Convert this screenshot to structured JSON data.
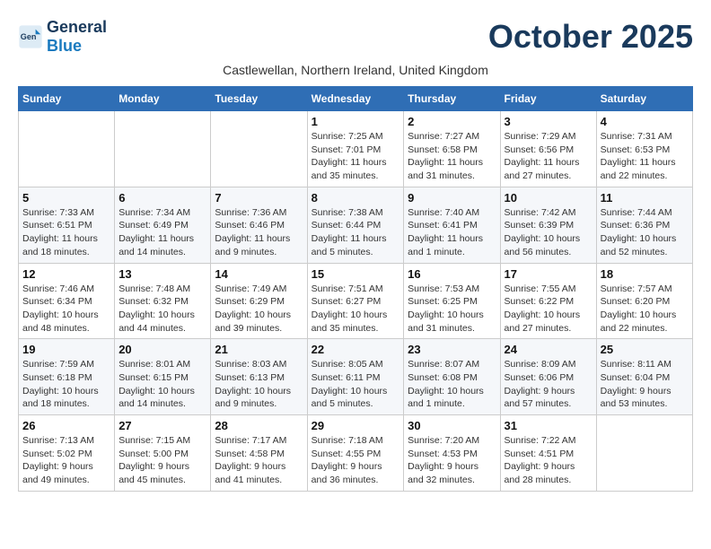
{
  "header": {
    "logo_general": "General",
    "logo_blue": "Blue",
    "month_title": "October 2025",
    "subtitle": "Castlewellan, Northern Ireland, United Kingdom"
  },
  "weekdays": [
    "Sunday",
    "Monday",
    "Tuesday",
    "Wednesday",
    "Thursday",
    "Friday",
    "Saturday"
  ],
  "weeks": [
    [
      {
        "day": "",
        "info": ""
      },
      {
        "day": "",
        "info": ""
      },
      {
        "day": "",
        "info": ""
      },
      {
        "day": "1",
        "info": "Sunrise: 7:25 AM\nSunset: 7:01 PM\nDaylight: 11 hours and 35 minutes."
      },
      {
        "day": "2",
        "info": "Sunrise: 7:27 AM\nSunset: 6:58 PM\nDaylight: 11 hours and 31 minutes."
      },
      {
        "day": "3",
        "info": "Sunrise: 7:29 AM\nSunset: 6:56 PM\nDaylight: 11 hours and 27 minutes."
      },
      {
        "day": "4",
        "info": "Sunrise: 7:31 AM\nSunset: 6:53 PM\nDaylight: 11 hours and 22 minutes."
      }
    ],
    [
      {
        "day": "5",
        "info": "Sunrise: 7:33 AM\nSunset: 6:51 PM\nDaylight: 11 hours and 18 minutes."
      },
      {
        "day": "6",
        "info": "Sunrise: 7:34 AM\nSunset: 6:49 PM\nDaylight: 11 hours and 14 minutes."
      },
      {
        "day": "7",
        "info": "Sunrise: 7:36 AM\nSunset: 6:46 PM\nDaylight: 11 hours and 9 minutes."
      },
      {
        "day": "8",
        "info": "Sunrise: 7:38 AM\nSunset: 6:44 PM\nDaylight: 11 hours and 5 minutes."
      },
      {
        "day": "9",
        "info": "Sunrise: 7:40 AM\nSunset: 6:41 PM\nDaylight: 11 hours and 1 minute."
      },
      {
        "day": "10",
        "info": "Sunrise: 7:42 AM\nSunset: 6:39 PM\nDaylight: 10 hours and 56 minutes."
      },
      {
        "day": "11",
        "info": "Sunrise: 7:44 AM\nSunset: 6:36 PM\nDaylight: 10 hours and 52 minutes."
      }
    ],
    [
      {
        "day": "12",
        "info": "Sunrise: 7:46 AM\nSunset: 6:34 PM\nDaylight: 10 hours and 48 minutes."
      },
      {
        "day": "13",
        "info": "Sunrise: 7:48 AM\nSunset: 6:32 PM\nDaylight: 10 hours and 44 minutes."
      },
      {
        "day": "14",
        "info": "Sunrise: 7:49 AM\nSunset: 6:29 PM\nDaylight: 10 hours and 39 minutes."
      },
      {
        "day": "15",
        "info": "Sunrise: 7:51 AM\nSunset: 6:27 PM\nDaylight: 10 hours and 35 minutes."
      },
      {
        "day": "16",
        "info": "Sunrise: 7:53 AM\nSunset: 6:25 PM\nDaylight: 10 hours and 31 minutes."
      },
      {
        "day": "17",
        "info": "Sunrise: 7:55 AM\nSunset: 6:22 PM\nDaylight: 10 hours and 27 minutes."
      },
      {
        "day": "18",
        "info": "Sunrise: 7:57 AM\nSunset: 6:20 PM\nDaylight: 10 hours and 22 minutes."
      }
    ],
    [
      {
        "day": "19",
        "info": "Sunrise: 7:59 AM\nSunset: 6:18 PM\nDaylight: 10 hours and 18 minutes."
      },
      {
        "day": "20",
        "info": "Sunrise: 8:01 AM\nSunset: 6:15 PM\nDaylight: 10 hours and 14 minutes."
      },
      {
        "day": "21",
        "info": "Sunrise: 8:03 AM\nSunset: 6:13 PM\nDaylight: 10 hours and 9 minutes."
      },
      {
        "day": "22",
        "info": "Sunrise: 8:05 AM\nSunset: 6:11 PM\nDaylight: 10 hours and 5 minutes."
      },
      {
        "day": "23",
        "info": "Sunrise: 8:07 AM\nSunset: 6:08 PM\nDaylight: 10 hours and 1 minute."
      },
      {
        "day": "24",
        "info": "Sunrise: 8:09 AM\nSunset: 6:06 PM\nDaylight: 9 hours and 57 minutes."
      },
      {
        "day": "25",
        "info": "Sunrise: 8:11 AM\nSunset: 6:04 PM\nDaylight: 9 hours and 53 minutes."
      }
    ],
    [
      {
        "day": "26",
        "info": "Sunrise: 7:13 AM\nSunset: 5:02 PM\nDaylight: 9 hours and 49 minutes."
      },
      {
        "day": "27",
        "info": "Sunrise: 7:15 AM\nSunset: 5:00 PM\nDaylight: 9 hours and 45 minutes."
      },
      {
        "day": "28",
        "info": "Sunrise: 7:17 AM\nSunset: 4:58 PM\nDaylight: 9 hours and 41 minutes."
      },
      {
        "day": "29",
        "info": "Sunrise: 7:18 AM\nSunset: 4:55 PM\nDaylight: 9 hours and 36 minutes."
      },
      {
        "day": "30",
        "info": "Sunrise: 7:20 AM\nSunset: 4:53 PM\nDaylight: 9 hours and 32 minutes."
      },
      {
        "day": "31",
        "info": "Sunrise: 7:22 AM\nSunset: 4:51 PM\nDaylight: 9 hours and 28 minutes."
      },
      {
        "day": "",
        "info": ""
      }
    ]
  ]
}
